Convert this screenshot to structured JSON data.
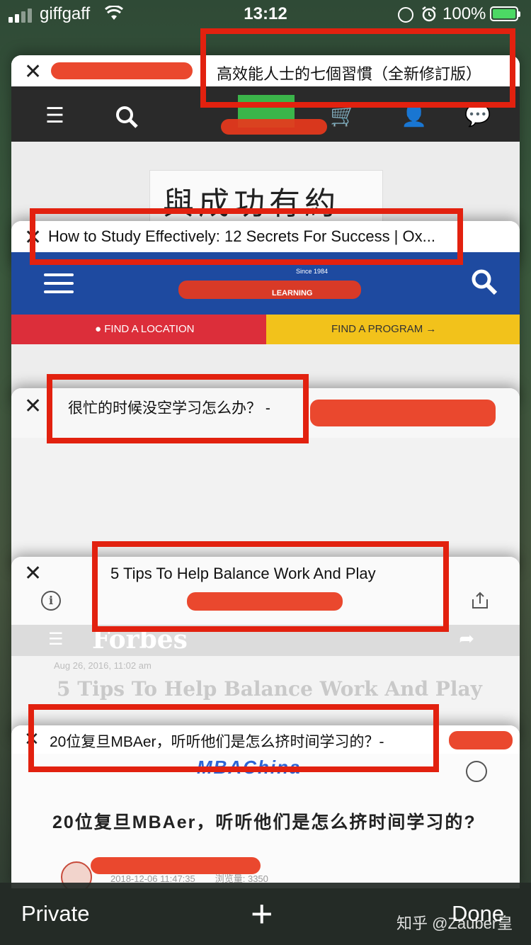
{
  "status_bar": {
    "carrier": "giffgaff",
    "time": "13:12",
    "battery": "100%",
    "icons": [
      "signal-icon",
      "wifi-icon",
      "orientation-lock-icon",
      "alarm-icon",
      "battery-charging-icon"
    ]
  },
  "tabs": [
    {
      "title": "高效能人士的七個習慣（全新修訂版）",
      "page": {
        "book_cover_text": "與成功有約"
      }
    },
    {
      "title": "How to Study Effectively: 12 Secrets For Success | Ox...",
      "page": {
        "logo_tagline": "Since 1984",
        "logo_word": "LEARNING",
        "find_location": "FIND A LOCATION",
        "find_program": "FIND A PROGRAM"
      }
    },
    {
      "title": "很忙的时候没空学习怎么办？ -"
    },
    {
      "title": "5 Tips To Help Balance Work And Play",
      "page": {
        "brand": "Forbes",
        "date": "Aug 26, 2016, 11:02 am",
        "headline": "5 Tips To Help Balance Work And Play"
      }
    },
    {
      "title": "20位复旦MBAer，听听他们是怎么挤时间学习的？-",
      "page": {
        "logo": "MBAChina",
        "headline": "20位复旦MBAer，听听他们是怎么挤时间学习的?",
        "date": "2018-12-06 11:47:35",
        "views": "浏览量: 3350"
      }
    }
  ],
  "toolbar": {
    "private_label": "Private",
    "new_tab_label": "+",
    "done_label": "Done"
  },
  "watermark": "知乎 @Zauber皇",
  "colors": {
    "highlight": "#e2210f",
    "redaction": "#e8381c",
    "charging": "#4cd964"
  }
}
